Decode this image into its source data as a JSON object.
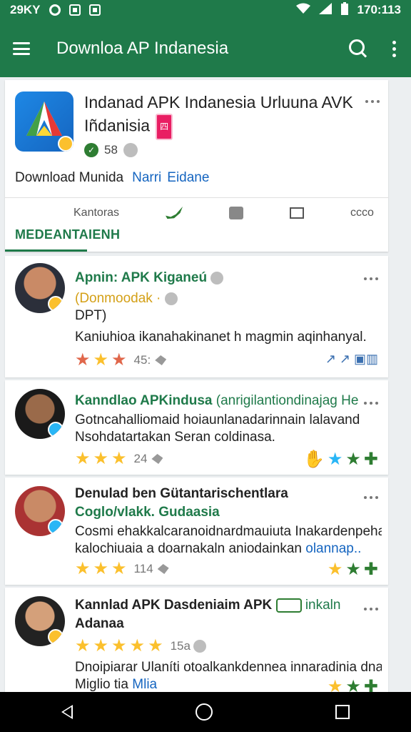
{
  "status_bar": {
    "left_text": "29KY",
    "time": "170:113"
  },
  "toolbar": {
    "title": "Downloa AP Indanesia"
  },
  "app": {
    "title": "Indanad APK Indanesia Urluuna AVK Iñdanisia",
    "tag": "四",
    "rating": "58",
    "download_text": "Download Munida",
    "link1": "Narri",
    "link2": "Eidane",
    "share_label": "Kantoras",
    "more_label": "ccco",
    "tab_label": "MEDEANTAIENH"
  },
  "reviews": [
    {
      "title": "Apnin: APK Kiganeú",
      "line1": "(Donmoodak ·",
      "line2": "DPT)",
      "body": "Kaniuhioa ikanahakinanet h magmin aqinhanyal.",
      "count": "45:",
      "right_text": "↗ ↗ ▣▥",
      "star_color": "red",
      "stars": 3
    },
    {
      "title": "Kanndlao APKindusa",
      "title_green": "(anrigilantiondinajag He",
      "body1": "Gotncahalliomaid hoiaunlanadarinnain lalavand",
      "body2": "Nsohdatartakan Seran coldinasa.",
      "count": "24",
      "stars": 3
    },
    {
      "title": "Denulad ben Gütantarischentlara",
      "title_green": "Coglo/vlakk. Gudaasia",
      "body1": "Cosmi ehakkalcaranoidnardmauiuta Inakardenpehatara",
      "body2": "kalochiuaia a doarnakaln aniodainkan",
      "link": "olannap..",
      "count": "114",
      "stars": 3
    },
    {
      "title": "Kannlad APK Dasdeniaim APK",
      "title_green": "inkaln",
      "title2": "Adanaa",
      "count": "15a",
      "body1": "Dnoipiarar Ulaníti otoalkankdennea innaradinia dnakaie",
      "body2": "Miglio tia",
      "link": "Mlia",
      "stars": 5
    }
  ]
}
